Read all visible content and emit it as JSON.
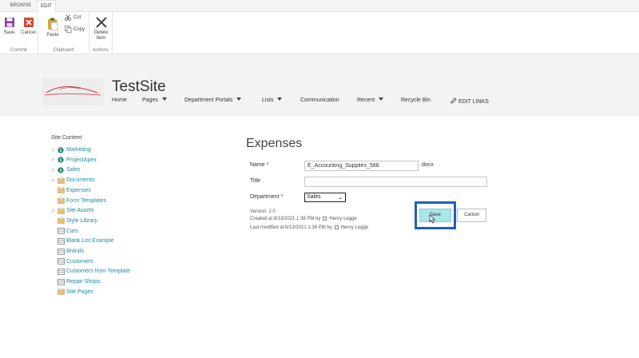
{
  "ribbon_tabs": [
    "BROWSE",
    "EDIT"
  ],
  "ribbon": {
    "commit": {
      "label": "Commit",
      "save": "Save",
      "cancel": "Cancel"
    },
    "clipboard": {
      "label": "Clipboard",
      "paste": "Paste",
      "cut": "Cut",
      "copy": "Copy"
    },
    "actions": {
      "label": "Actions",
      "delete_line1": "Delete",
      "delete_line2": "Item"
    }
  },
  "site": {
    "title": "TestSite"
  },
  "nav": [
    {
      "label": "Home",
      "dropdown": false
    },
    {
      "label": "Pages",
      "dropdown": true
    },
    {
      "label": "Department Portals",
      "dropdown": true
    },
    {
      "label": "Lists",
      "dropdown": true
    },
    {
      "label": "Communication",
      "dropdown": false
    },
    {
      "label": "Recent",
      "dropdown": true
    },
    {
      "label": "Recycle Bin",
      "dropdown": false
    }
  ],
  "edit_links": "EDIT LINKS",
  "quick_launch": {
    "title": "Site Content",
    "items": [
      {
        "label": "Marketing",
        "icon": "site-icon",
        "expandable": true
      },
      {
        "label": "ProjectApex",
        "icon": "site-icon",
        "expandable": true
      },
      {
        "label": "Sales",
        "icon": "site-icon",
        "expandable": true
      },
      {
        "label": "Documents",
        "icon": "library-icon",
        "expandable": true
      },
      {
        "label": "Expenses",
        "icon": "library-icon",
        "expandable": false
      },
      {
        "label": "Form Templates",
        "icon": "library-icon",
        "expandable": false
      },
      {
        "label": "Site Assets",
        "icon": "library-icon",
        "expandable": true
      },
      {
        "label": "Style Library",
        "icon": "library-icon",
        "expandable": false
      },
      {
        "label": "Cars",
        "icon": "list-icon",
        "expandable": false
      },
      {
        "label": "Blank List Example",
        "icon": "list-icon",
        "expandable": false
      },
      {
        "label": "Brands",
        "icon": "list-icon",
        "expandable": false
      },
      {
        "label": "Customers",
        "icon": "list-icon",
        "expandable": false
      },
      {
        "label": "Customers from Template",
        "icon": "list-icon",
        "expandable": false
      },
      {
        "label": "Repair Shops",
        "icon": "list-icon",
        "expandable": false
      },
      {
        "label": "Site Pages",
        "icon": "library-icon",
        "expandable": false
      }
    ]
  },
  "form": {
    "title": "Expenses",
    "name_label": "Name",
    "name_value": "E_Accounting_Supplies_586",
    "name_suffix": ".docx",
    "title_label": "Title",
    "title_value": "",
    "department_label": "Department",
    "department_value": "Sales",
    "version": "Version: 2.0",
    "created": "Created at 8/13/2021 1:38 PM  by",
    "created_by": "Henry Legge",
    "modified": "Last modified at 8/13/2021 1:39 PM  by",
    "modified_by": "Henry Legge",
    "save_label": "Save",
    "cancel_label": "Cancel"
  },
  "colors": {
    "link": "#1a8aa8",
    "save_button": "#a8e6e8",
    "highlight": "#1f60b2",
    "site_icon": "#0f7b6c"
  }
}
